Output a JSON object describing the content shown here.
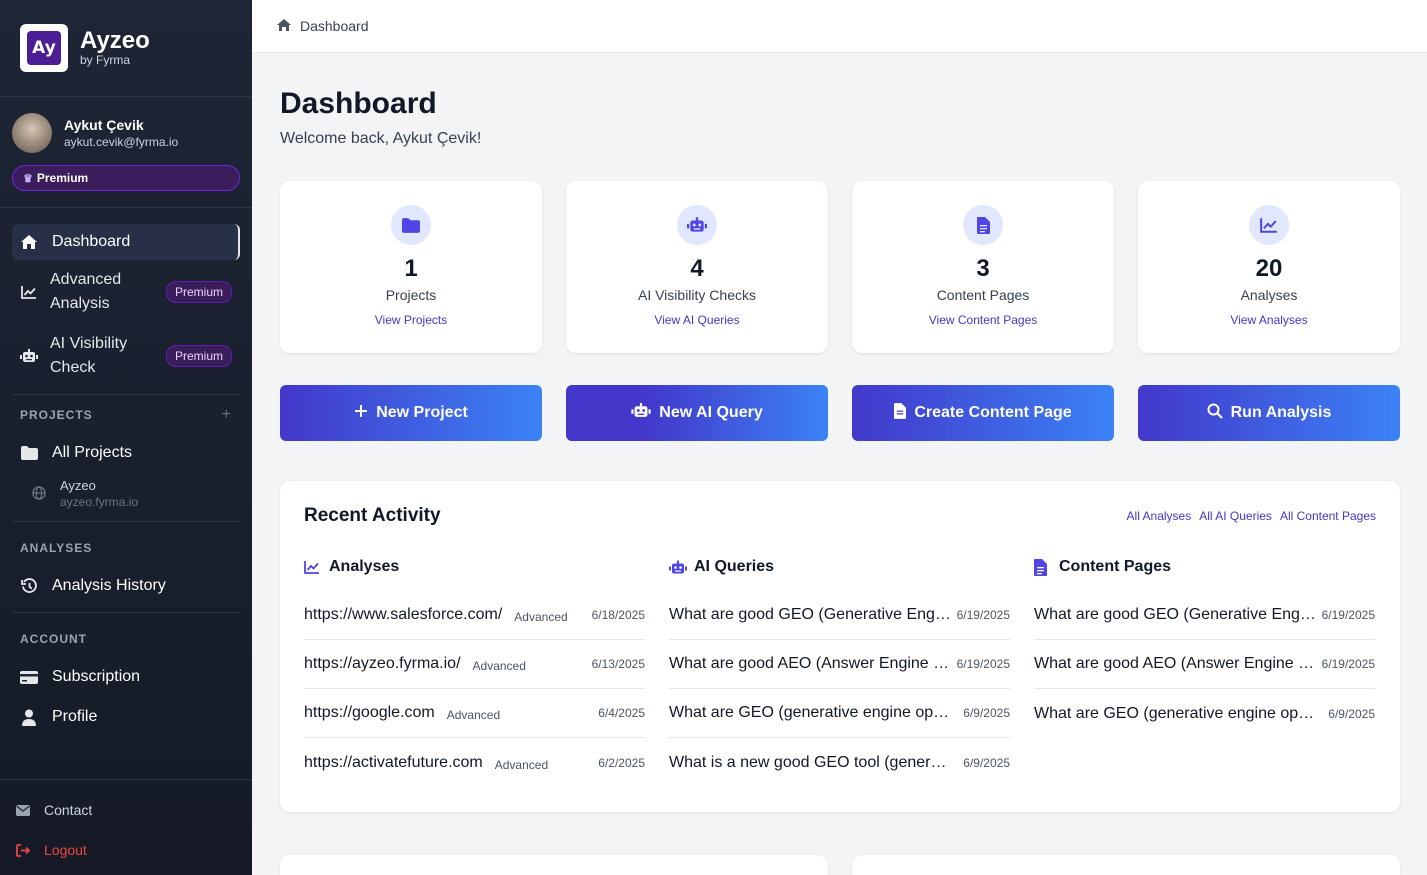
{
  "brand": {
    "logo_text": "Ay",
    "name": "Ayzeo",
    "sub": "by Fyrma"
  },
  "user": {
    "name": "Aykut Çevik",
    "email": "aykut.cevik@fyrma.io",
    "plan": "Premium"
  },
  "nav": {
    "dashboard": "Dashboard",
    "advanced": {
      "label": "Advanced Analysis",
      "badge": "Premium"
    },
    "visibility": {
      "label": "AI Visibility Check",
      "badge": "Premium"
    }
  },
  "projects": {
    "heading": "PROJECTS",
    "plus": "+",
    "all": "All Projects",
    "items": [
      {
        "name": "Ayzeo",
        "url": "ayzeo.fyrma.io"
      }
    ]
  },
  "analyses_section": {
    "heading": "ANALYSES",
    "history": "Analysis History"
  },
  "account_section": {
    "heading": "ACCOUNT",
    "subscription": "Subscription",
    "profile": "Profile"
  },
  "footer": {
    "contact": "Contact",
    "logout": "Logout"
  },
  "breadcrumb": "Dashboard",
  "page": {
    "title": "Dashboard",
    "welcome": "Welcome back, Aykut Çevik!"
  },
  "stats": [
    {
      "value": "1",
      "label": "Projects",
      "link": "View Projects",
      "icon": "folder-icon"
    },
    {
      "value": "4",
      "label": "AI Visibility Checks",
      "link": "View AI Queries",
      "icon": "robot-icon"
    },
    {
      "value": "3",
      "label": "Content Pages",
      "link": "View Content Pages",
      "icon": "document-icon"
    },
    {
      "value": "20",
      "label": "Analyses",
      "link": "View Analyses",
      "icon": "chart-line-icon"
    }
  ],
  "actions": [
    {
      "label": "New Project",
      "icon": "plus-icon"
    },
    {
      "label": "New AI Query",
      "icon": "robot-icon"
    },
    {
      "label": "Create Content Page",
      "icon": "document-icon"
    },
    {
      "label": "Run Analysis",
      "icon": "search-icon"
    }
  ],
  "activity": {
    "title": "Recent Activity",
    "links": [
      "All Analyses",
      "All AI Queries",
      "All Content Pages"
    ],
    "analyses": {
      "heading": "Analyses",
      "rows": [
        {
          "url": "https://www.salesforce.com/",
          "tag": "Advanced",
          "date": "6/18/2025"
        },
        {
          "url": "https://ayzeo.fyrma.io/",
          "tag": "Advanced",
          "date": "6/13/2025"
        },
        {
          "url": "https://google.com",
          "tag": "Advanced",
          "date": "6/4/2025"
        },
        {
          "url": "https://activatefuture.com",
          "tag": "Advanced",
          "date": "6/2/2025"
        }
      ]
    },
    "queries": {
      "heading": "AI Queries",
      "rows": [
        {
          "text": "What are good GEO (Generative Engine Optimization) tools?",
          "date": "6/19/2025"
        },
        {
          "text": "What are good AEO (Answer Engine Optimization) tools?",
          "date": "6/19/2025"
        },
        {
          "text": "What are GEO (generative engine optimization) tools?",
          "date": "6/9/2025"
        },
        {
          "text": "What is a new good GEO tool (generative engine optimization)?",
          "date": "6/9/2025"
        }
      ]
    },
    "content": {
      "heading": "Content Pages",
      "rows": [
        {
          "text": "What are good GEO (Generative Engine Optimization) tools?",
          "date": "6/19/2025"
        },
        {
          "text": "What are good AEO (Answer Engine Optimization) tools?",
          "date": "6/19/2025"
        },
        {
          "text": "What are GEO (generative engine optimization) tools?",
          "date": "6/9/2025"
        }
      ]
    }
  },
  "colors": {
    "accent": "#4338ca",
    "accent_light": "#3b82f6",
    "sidebar": "#1e2535",
    "premium": "#3b1d5c",
    "logout": "#ef4444"
  }
}
